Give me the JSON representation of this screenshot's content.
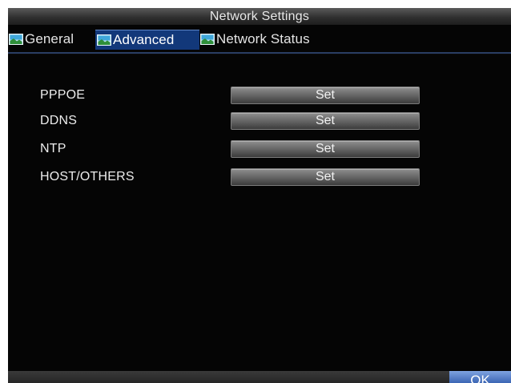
{
  "window": {
    "title": "Network Settings"
  },
  "tabs": [
    {
      "label": "General",
      "icon": "landscape-icon",
      "active": false
    },
    {
      "label": "Advanced",
      "icon": "landscape-icon",
      "active": true
    },
    {
      "label": "Network Status",
      "icon": "landscape-icon",
      "active": false
    }
  ],
  "settings": [
    {
      "label": "PPPOE",
      "button_label": "Set"
    },
    {
      "label": "DDNS",
      "button_label": "Set"
    },
    {
      "label": "NTP",
      "button_label": "Set"
    },
    {
      "label": "HOST/OTHERS",
      "button_label": "Set"
    }
  ],
  "footer": {
    "ok_label": "OK"
  },
  "colors": {
    "accent": "#12387a",
    "background": "#050505"
  }
}
